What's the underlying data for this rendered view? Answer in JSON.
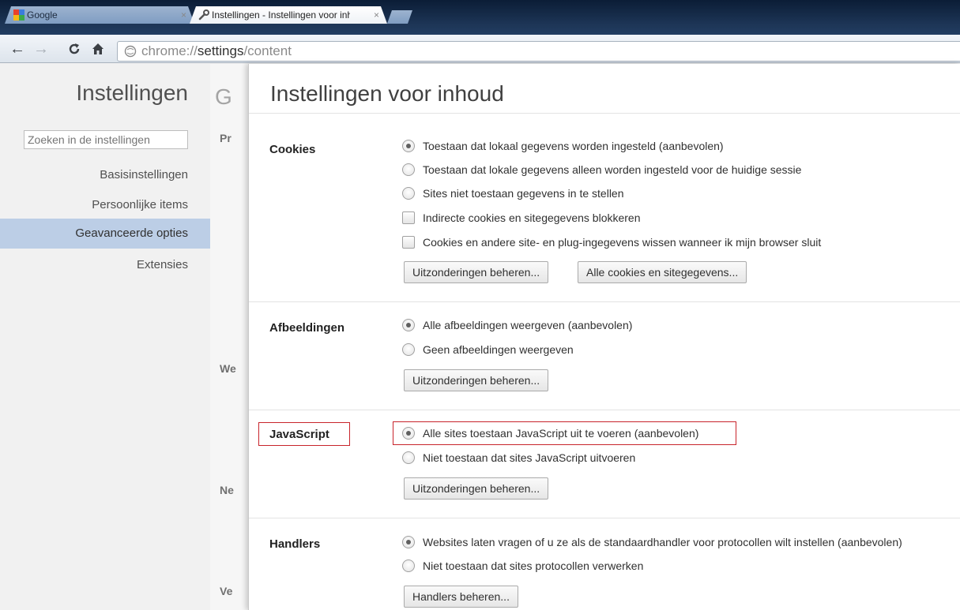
{
  "tabs": [
    {
      "label": "Google",
      "active": false
    },
    {
      "label": "Instellingen - Instellingen voor inhoud",
      "active": true
    }
  ],
  "toolbar": {
    "url_scheme": "chrome://",
    "url_host": "settings",
    "url_path": "/content"
  },
  "sidebar": {
    "title": "Instellingen",
    "search_placeholder": "Zoeken in de instellingen",
    "items": [
      {
        "label": "Basisinstellingen",
        "selected": false
      },
      {
        "label": "Persoonlijke items",
        "selected": false
      },
      {
        "label": "Geavanceerde opties",
        "selected": true
      },
      {
        "label": "Extensies",
        "selected": false
      }
    ]
  },
  "background_page": {
    "heading": "G",
    "fragments": [
      "Pr",
      "We",
      "Ne",
      "Ve"
    ]
  },
  "dialog": {
    "title": "Instellingen voor inhoud",
    "sections": {
      "cookies": {
        "title": "Cookies",
        "options": [
          {
            "label": "Toestaan dat lokaal gegevens worden ingesteld (aanbevolen)",
            "type": "radio",
            "checked": true
          },
          {
            "label": "Toestaan dat lokale gegevens alleen worden ingesteld voor de huidige sessie",
            "type": "radio",
            "checked": false
          },
          {
            "label": "Sites niet toestaan gegevens in te stellen",
            "type": "radio",
            "checked": false
          },
          {
            "label": "Indirecte cookies en sitegegevens blokkeren",
            "type": "checkbox",
            "checked": false
          },
          {
            "label": "Cookies en andere site- en plug-ingegevens wissen wanneer ik mijn browser sluit",
            "type": "checkbox",
            "checked": false
          }
        ],
        "buttons": [
          "Uitzonderingen beheren...",
          "Alle cookies en sitegegevens..."
        ]
      },
      "images": {
        "title": "Afbeeldingen",
        "options": [
          {
            "label": "Alle afbeeldingen weergeven (aanbevolen)",
            "type": "radio",
            "checked": true
          },
          {
            "label": "Geen afbeeldingen weergeven",
            "type": "radio",
            "checked": false
          }
        ],
        "buttons": [
          "Uitzonderingen beheren..."
        ]
      },
      "javascript": {
        "title": "JavaScript",
        "options": [
          {
            "label": "Alle sites toestaan JavaScript uit te voeren (aanbevolen)",
            "type": "radio",
            "checked": true
          },
          {
            "label": "Niet toestaan dat sites JavaScript uitvoeren",
            "type": "radio",
            "checked": false
          }
        ],
        "buttons": [
          "Uitzonderingen beheren..."
        ]
      },
      "handlers": {
        "title": "Handlers",
        "options": [
          {
            "label": "Websites laten vragen of u ze als de standaardhandler voor protocollen wilt instellen (aanbevolen)",
            "type": "radio",
            "checked": true
          },
          {
            "label": "Niet toestaan dat sites protocollen verwerken",
            "type": "radio",
            "checked": false
          }
        ],
        "buttons": [
          "Handlers beheren..."
        ]
      }
    }
  },
  "colors": {
    "highlight": "#c8242b",
    "selected_sidebar": "#bccee6"
  }
}
